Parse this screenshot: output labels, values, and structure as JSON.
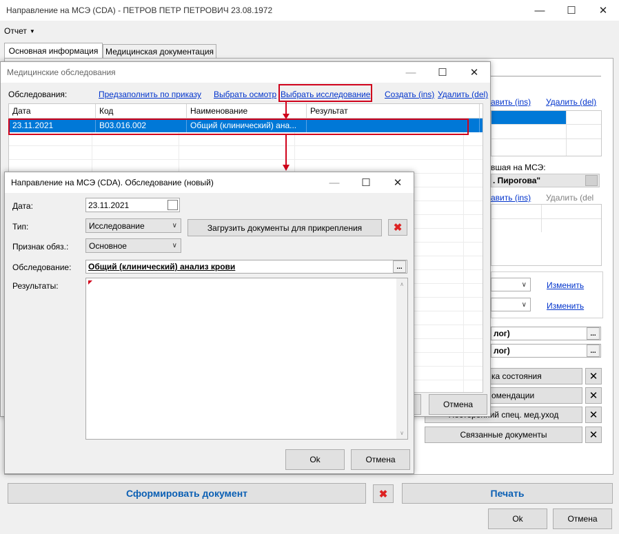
{
  "main": {
    "title": "Направление на МСЭ (CDA) - ПЕТРОВ ПЕТР ПЕТРОВИЧ 23.08.1972",
    "menu": "Отчет",
    "tabs": [
      "Основная информация",
      "Медицинская документация"
    ],
    "bg": {
      "link_add1": "авить (ins)",
      "link_del1": "Удалить (del)",
      "sent_label": "вшая на МСЭ:",
      "sent_value": ". Пирогова\"",
      "link_add2": "авить (ins)",
      "link_del2": "Удалить (del",
      "change1": "Изменить",
      "change2": "Изменить",
      "field1": "лог)",
      "field2": "лог)",
      "btn_state": "ка состояния",
      "btn_recs": "омендации",
      "btn_care": "Посторонний спец. мед.уход",
      "btn_related": "Связанные документы"
    },
    "form_doc": "Сформировать документ",
    "print": "Печать",
    "ok": "Ok",
    "cancel": "Отмена"
  },
  "exams": {
    "title": "Медицинские обследования",
    "label": "Обследования:",
    "links": [
      "Предзаполнить по приказу",
      "Выбрать осмотр",
      "Выбрать исследование",
      "Создать (ins)",
      "Удалить (del)"
    ],
    "columns": [
      "Дата",
      "Код",
      "Наименование",
      "Результат"
    ],
    "rows": [
      {
        "date": "23.11.2021",
        "code": "B03.016.002",
        "name": "Общий (клинический) ана...",
        "result": ""
      }
    ],
    "cancel": "Отмена"
  },
  "dialog": {
    "title": "Направление на МСЭ (CDA). Обследование (новый)",
    "date_label": "Дата:",
    "date_value": "23.11.2021",
    "type_label": "Тип:",
    "type_value": "Исследование",
    "upload_button": "Загрузить документы для прикрепления",
    "flag_label": "Признак обяз.:",
    "flag_value": "Основное",
    "exam_label": "Обследование:",
    "exam_value": "Общий (клинический) анализ крови",
    "results_label": "Результаты:",
    "ok": "Ok",
    "cancel": "Отмена"
  },
  "colors": {
    "selection": "#0078d7",
    "highlight": "#d0021b",
    "link": "#0033cc",
    "action_text": "#0a5fb4"
  }
}
